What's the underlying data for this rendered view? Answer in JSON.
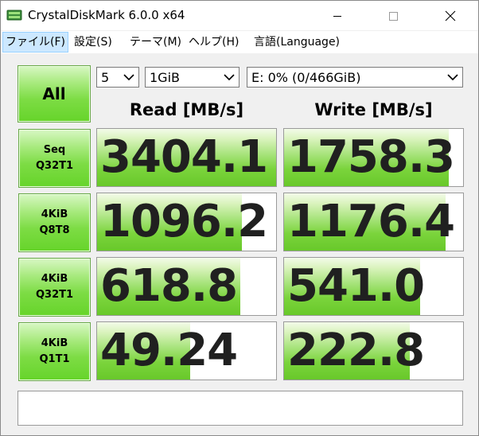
{
  "window": {
    "title": "CrystalDiskMark 6.0.0 x64"
  },
  "menu": [
    {
      "label": "ファイル(F)"
    },
    {
      "label": "設定(S)"
    },
    {
      "label": "テーマ(M)"
    },
    {
      "label": "ヘルプ(H)"
    },
    {
      "label": "言語(Language)"
    }
  ],
  "controls": {
    "all_button": "All",
    "count": "5",
    "size": "1GiB",
    "drive": "E: 0% (0/466GiB)"
  },
  "headers": {
    "read": "Read [MB/s]",
    "write": "Write [MB/s]"
  },
  "tests": [
    {
      "line1": "Seq",
      "line2": "Q32T1",
      "read": "3404.1",
      "write": "1758.3",
      "read_fill": 1.0,
      "write_fill": 0.92
    },
    {
      "line1": "4KiB",
      "line2": "Q8T8",
      "read": "1096.2",
      "write": "1176.4",
      "read_fill": 0.81,
      "write_fill": 0.9
    },
    {
      "line1": "4KiB",
      "line2": "Q32T1",
      "read": "618.8",
      "write": "541.0",
      "read_fill": 0.8,
      "write_fill": 0.76
    },
    {
      "line1": "4KiB",
      "line2": "Q1T1",
      "read": "49.24",
      "write": "222.8",
      "read_fill": 0.52,
      "write_fill": 0.7
    }
  ],
  "comment": "",
  "colors": {
    "accent_green": "#66d42a",
    "menu_highlight": "#cce8ff"
  },
  "icons": [
    "app-icon",
    "minimize-icon",
    "maximize-icon",
    "close-icon",
    "chevron-down-icon"
  ]
}
